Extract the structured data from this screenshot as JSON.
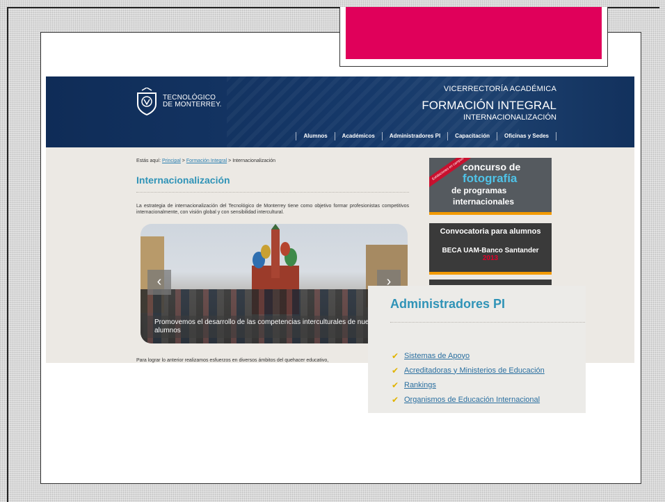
{
  "logo": {
    "line1": "TECNOLÓGICO",
    "line2": "DE MONTERREY."
  },
  "header": {
    "vicerrectoria": "VICERRECTORÍA ACADÉMICA",
    "formacion": "FORMACIÓN INTEGRAL",
    "section": "INTERNACIONALIZACIÓN"
  },
  "nav": {
    "items": [
      "Alumnos",
      "Académicos",
      "Administradores PI",
      "Capacitación",
      "Oficinas y Sedes"
    ]
  },
  "breadcrumb": {
    "prefix": "Estás aquí:",
    "home": "Principal",
    "sep": ">",
    "parent": "Formación Integral",
    "current": "Internacionalización"
  },
  "page": {
    "title": "Internacionalización",
    "intro": "La estrategia de internacionalización del Tecnológico de Monterrey tiene como objetivo formar profesionistas competitivos internacionalmente, con visión global y con sensibilidad intercultural.",
    "body": "Para lograr lo anterior realizamos esfuerzos en diversos ámbitos del quehacer educativo,"
  },
  "slider": {
    "caption": "Promovemos el desarrollo de las competencias interculturales de nuestros alumnos",
    "prev": "‹",
    "next": "›"
  },
  "banner1": {
    "stripe": "Exhibiciones en campus",
    "l1": "concurso de",
    "l2": "fotografía",
    "l3": "de programas",
    "l4": "internacionales"
  },
  "banner2": {
    "l1": "Convocatoria para alumnos",
    "l2": "BECA UAM-Banco Santander",
    "l3": "2013"
  },
  "zoom": {
    "title": "Administradores PI",
    "links": [
      "Sistemas de Apoyo",
      "Acreditadoras y Ministerios de Educación",
      "Rankings",
      "Organismos de Educación Internacional"
    ],
    "check": "✔"
  },
  "colors": {
    "accent_pink": "#e0005a",
    "header_navy": "#0f2c57",
    "title_blue": "#2f93b7",
    "orange": "#f39a00"
  }
}
